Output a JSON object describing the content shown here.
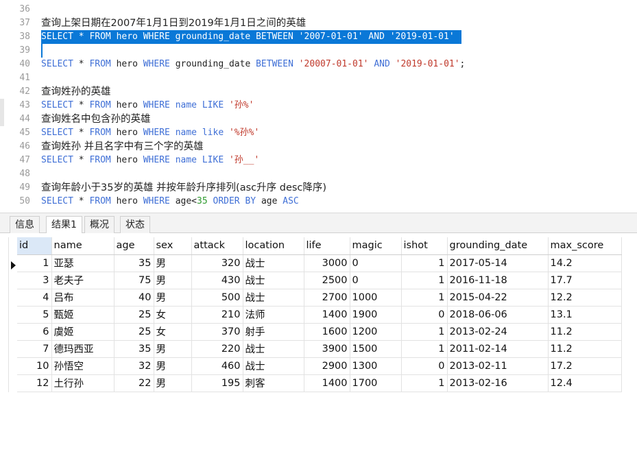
{
  "editor": {
    "lines": [
      {
        "num": "36",
        "segments": []
      },
      {
        "num": "37",
        "segments": [
          {
            "t": "查询上架日期在2007年1月1日到2019年1月1日之间的英雄",
            "c": "cn"
          }
        ]
      },
      {
        "num": "38",
        "selected": true,
        "segments": [
          {
            "t": "SELECT * FROM hero WHERE grounding_date BETWEEN '2007-01-01' AND '2019-01-01'",
            "c": ""
          }
        ]
      },
      {
        "num": "39",
        "segments": []
      },
      {
        "num": "40",
        "segments": [
          {
            "t": "SELECT",
            "c": "kw"
          },
          {
            "t": " * ",
            "c": ""
          },
          {
            "t": "FROM",
            "c": "kw"
          },
          {
            "t": " hero ",
            "c": ""
          },
          {
            "t": "WHERE",
            "c": "kw"
          },
          {
            "t": " grounding_date ",
            "c": ""
          },
          {
            "t": "BETWEEN",
            "c": "kw"
          },
          {
            "t": " ",
            "c": ""
          },
          {
            "t": "'20007-01-01'",
            "c": "str"
          },
          {
            "t": " ",
            "c": ""
          },
          {
            "t": "AND",
            "c": "kw"
          },
          {
            "t": " ",
            "c": ""
          },
          {
            "t": "'2019-01-01'",
            "c": "str"
          },
          {
            "t": ";",
            "c": ""
          }
        ]
      },
      {
        "num": "41",
        "segments": []
      },
      {
        "num": "42",
        "segments": [
          {
            "t": "查询姓孙的英雄",
            "c": "cn"
          }
        ]
      },
      {
        "num": "43",
        "segments": [
          {
            "t": "SELECT",
            "c": "kw"
          },
          {
            "t": " * ",
            "c": ""
          },
          {
            "t": "FROM",
            "c": "kw"
          },
          {
            "t": " hero ",
            "c": ""
          },
          {
            "t": "WHERE",
            "c": "kw"
          },
          {
            "t": " ",
            "c": ""
          },
          {
            "t": "name",
            "c": "kw"
          },
          {
            "t": " ",
            "c": ""
          },
          {
            "t": "LIKE",
            "c": "kw"
          },
          {
            "t": " ",
            "c": ""
          },
          {
            "t": "'孙%'",
            "c": "str"
          }
        ]
      },
      {
        "num": "44",
        "segments": [
          {
            "t": "查询姓名中包含孙的英雄",
            "c": "cn"
          }
        ]
      },
      {
        "num": "45",
        "segments": [
          {
            "t": "SELECT",
            "c": "kw"
          },
          {
            "t": " * ",
            "c": ""
          },
          {
            "t": "FROM",
            "c": "kw"
          },
          {
            "t": " hero ",
            "c": ""
          },
          {
            "t": "WHERE",
            "c": "kw"
          },
          {
            "t": " ",
            "c": ""
          },
          {
            "t": "name",
            "c": "kw"
          },
          {
            "t": " ",
            "c": ""
          },
          {
            "t": "like",
            "c": "kw"
          },
          {
            "t": " ",
            "c": ""
          },
          {
            "t": "'%孙%'",
            "c": "str"
          }
        ]
      },
      {
        "num": "46",
        "segments": [
          {
            "t": "查询姓孙 并且名字中有三个字的英雄",
            "c": "cn"
          }
        ]
      },
      {
        "num": "47",
        "segments": [
          {
            "t": "SELECT",
            "c": "kw"
          },
          {
            "t": " * ",
            "c": ""
          },
          {
            "t": "FROM",
            "c": "kw"
          },
          {
            "t": " hero ",
            "c": ""
          },
          {
            "t": "WHERE",
            "c": "kw"
          },
          {
            "t": " ",
            "c": ""
          },
          {
            "t": "name",
            "c": "kw"
          },
          {
            "t": " ",
            "c": ""
          },
          {
            "t": "LIKE",
            "c": "kw"
          },
          {
            "t": " ",
            "c": ""
          },
          {
            "t": "'孙__'",
            "c": "str"
          }
        ]
      },
      {
        "num": "48",
        "segments": []
      },
      {
        "num": "49",
        "segments": [
          {
            "t": "查询年龄小于35岁的英雄 并按年龄升序排列(asc升序 desc降序)",
            "c": "cn"
          }
        ]
      },
      {
        "num": "50",
        "segments": [
          {
            "t": "SELECT",
            "c": "kw"
          },
          {
            "t": " * ",
            "c": ""
          },
          {
            "t": "FROM",
            "c": "kw"
          },
          {
            "t": " hero ",
            "c": ""
          },
          {
            "t": "WHERE",
            "c": "kw"
          },
          {
            "t": " age<",
            "c": ""
          },
          {
            "t": "35",
            "c": "num"
          },
          {
            "t": " ",
            "c": ""
          },
          {
            "t": "ORDER",
            "c": "kw"
          },
          {
            "t": " ",
            "c": ""
          },
          {
            "t": "BY",
            "c": "kw"
          },
          {
            "t": " age ",
            "c": ""
          },
          {
            "t": "ASC",
            "c": "kw"
          }
        ]
      }
    ]
  },
  "tabs": [
    {
      "label": "信息",
      "active": false
    },
    {
      "label": "结果1",
      "active": true
    },
    {
      "label": "概况",
      "active": false
    },
    {
      "label": "状态",
      "active": false
    }
  ],
  "table": {
    "columns": [
      "id",
      "name",
      "age",
      "sex",
      "attack",
      "location",
      "life",
      "magic",
      "ishot",
      "grounding_date",
      "max_score"
    ],
    "rows": [
      [
        "1",
        "亚瑟",
        "35",
        "男",
        "320",
        "战士",
        "3000",
        "0",
        "1",
        "2017-05-14",
        "14.2"
      ],
      [
        "3",
        "老夫子",
        "75",
        "男",
        "430",
        "战士",
        "2500",
        "0",
        "1",
        "2016-11-18",
        "17.7"
      ],
      [
        "4",
        "吕布",
        "40",
        "男",
        "500",
        "战士",
        "2700",
        "1000",
        "1",
        "2015-04-22",
        "12.2"
      ],
      [
        "5",
        "甄姬",
        "25",
        "女",
        "210",
        "法师",
        "1400",
        "1900",
        "0",
        "2018-06-06",
        "13.1"
      ],
      [
        "6",
        "虞姬",
        "25",
        "女",
        "370",
        "射手",
        "1600",
        "1200",
        "1",
        "2013-02-24",
        "11.2"
      ],
      [
        "7",
        "德玛西亚",
        "35",
        "男",
        "220",
        "战士",
        "3900",
        "1500",
        "1",
        "2011-02-14",
        "11.2"
      ],
      [
        "10",
        "孙悟空",
        "32",
        "男",
        "460",
        "战士",
        "2900",
        "1300",
        "0",
        "2013-02-11",
        "17.2"
      ],
      [
        "12",
        "土行孙",
        "22",
        "男",
        "195",
        "刺客",
        "1400",
        "1700",
        "1",
        "2013-02-16",
        "12.4"
      ]
    ]
  }
}
